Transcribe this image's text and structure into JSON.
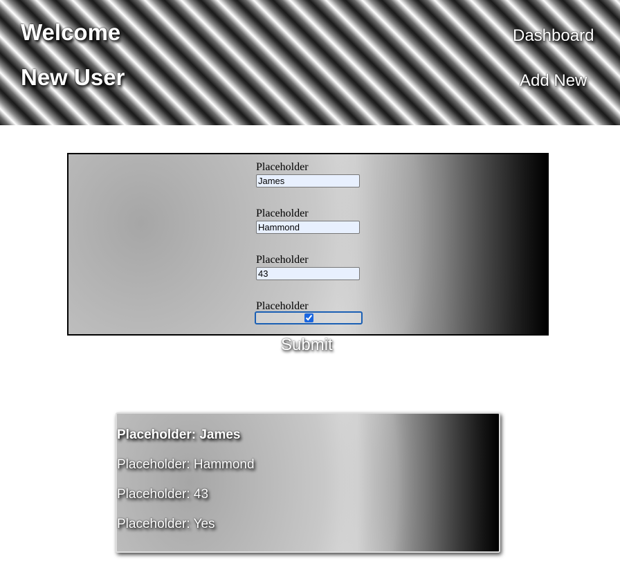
{
  "header": {
    "title_line1": "Welcome",
    "title_line2": "New User",
    "nav": {
      "dashboard": "Dashboard",
      "add_new": "Add New"
    }
  },
  "form": {
    "fields": [
      {
        "label": "Placeholder",
        "value": "James"
      },
      {
        "label": "Placeholder",
        "value": "Hammond"
      },
      {
        "label": "Placeholder",
        "value": "43"
      },
      {
        "label": "Placeholder",
        "checked": true
      }
    ],
    "submit_label": "Submit"
  },
  "result": {
    "lines": [
      "Placeholder: James",
      "Placeholder: Hammond",
      "Placeholder: 43",
      "Placeholder: Yes"
    ]
  },
  "colors": {
    "text": "#ffffff",
    "border": "#000000",
    "input_bg": "#e8f0fe",
    "checkbox_accent": "#1a66e0"
  }
}
